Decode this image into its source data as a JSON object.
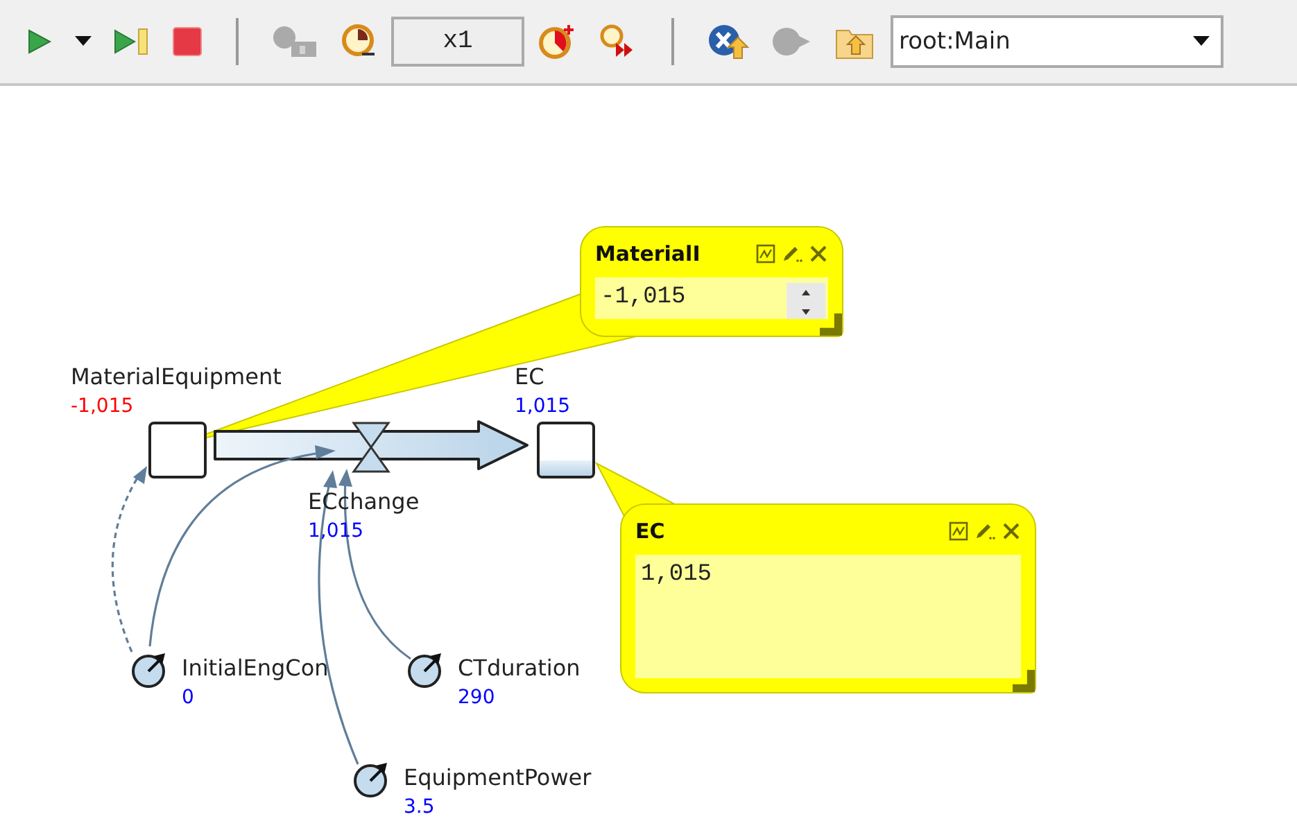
{
  "toolbar": {
    "items": [
      {
        "kind": "button",
        "disabled": false
      },
      {
        "kind": "button",
        "disabled": false
      },
      {
        "kind": "button",
        "disabled": false
      },
      {
        "kind": "button",
        "disabled": false
      },
      {
        "kind": "separator"
      },
      {
        "kind": "button",
        "disabled": true
      },
      {
        "kind": "button",
        "disabled": false
      },
      {
        "kind": "speed",
        "text": "x1"
      },
      {
        "kind": "button",
        "disabled": false
      },
      {
        "kind": "button",
        "disabled": false
      },
      {
        "kind": "separator"
      },
      {
        "kind": "button",
        "disabled": false
      },
      {
        "kind": "button",
        "disabled": true
      },
      {
        "kind": "button",
        "disabled": false
      },
      {
        "kind": "selector",
        "text": "root:Main"
      }
    ]
  },
  "stocks": [
    {
      "name": "MaterialEquipment",
      "value": "-1,015",
      "color": "#ff0000"
    },
    {
      "name": "EC",
      "value": "1,015",
      "color": "#0000ff"
    }
  ],
  "flows": [
    {
      "name": "ECchange",
      "value": "1,015",
      "color": "#0000ff"
    }
  ],
  "parameters": [
    {
      "name": "InitialEngCon",
      "value": "0",
      "color": "#0000ff"
    },
    {
      "name": "CTduration",
      "value": "290",
      "color": "#0000ff"
    },
    {
      "name": "EquipmentPower",
      "value": "3.5",
      "color": "#0000ff"
    }
  ],
  "inspect_windows": [
    {
      "title": "MaterialI",
      "value": "-1,015",
      "kind": "spinner"
    },
    {
      "title": "EC",
      "value": "1,015",
      "kind": "plain"
    }
  ]
}
